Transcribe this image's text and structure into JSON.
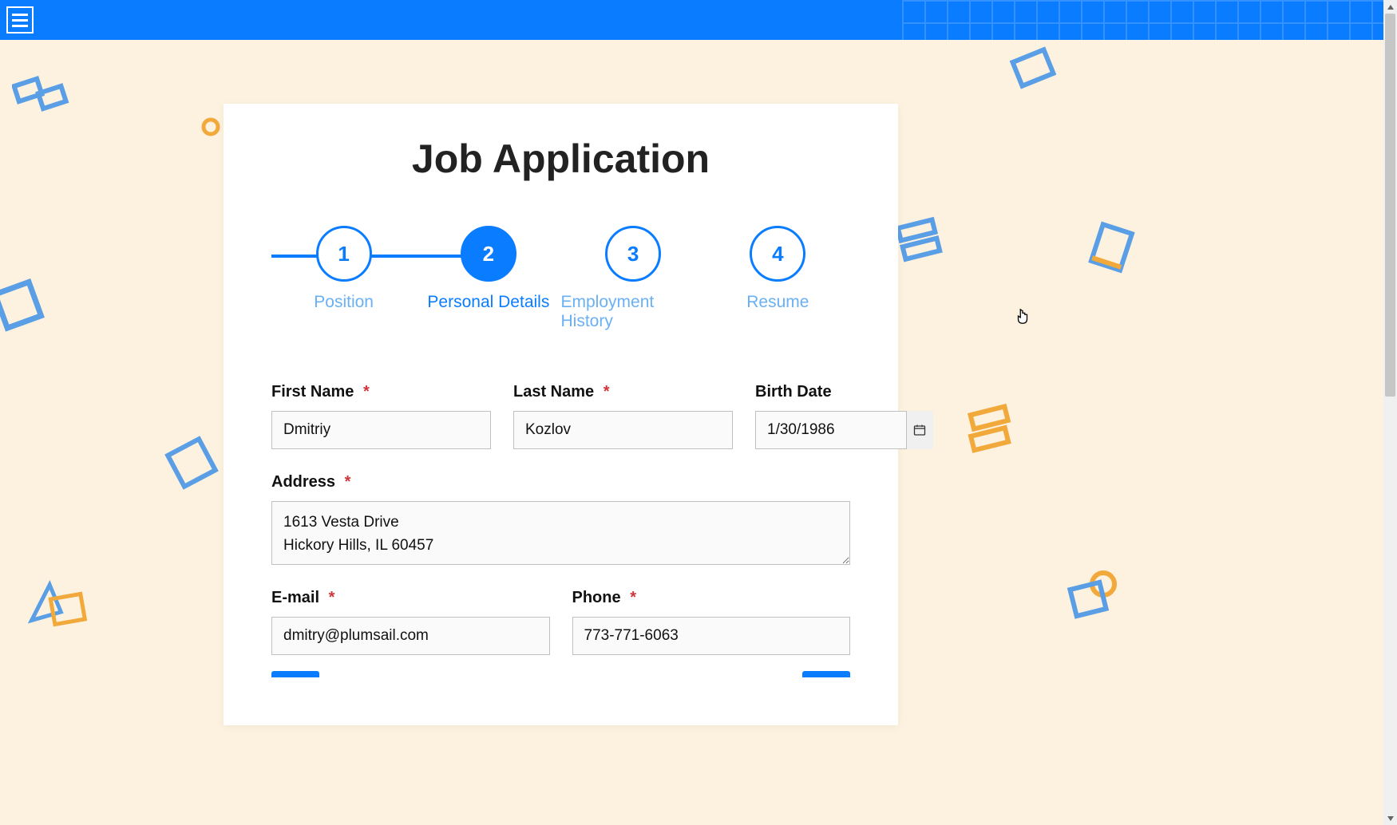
{
  "header": {
    "title": "Job Application"
  },
  "wizard": {
    "active_index": 1,
    "steps": [
      {
        "num": "1",
        "label": "Position"
      },
      {
        "num": "2",
        "label": "Personal Details"
      },
      {
        "num": "3",
        "label": "Employment History"
      },
      {
        "num": "4",
        "label": "Resume"
      }
    ]
  },
  "fields": {
    "first_name": {
      "label": "First Name",
      "required": true,
      "value": "Dmitriy"
    },
    "last_name": {
      "label": "Last Name",
      "required": true,
      "value": "Kozlov"
    },
    "birth_date": {
      "label": "Birth Date",
      "required": false,
      "value": "1/30/1986"
    },
    "address": {
      "label": "Address",
      "required": true,
      "value": "1613 Vesta Drive\nHickory Hills, IL 60457"
    },
    "email": {
      "label": "E-mail",
      "required": true,
      "value": "dmitry@plumsail.com"
    },
    "phone": {
      "label": "Phone",
      "required": true,
      "value": "773-771-6063"
    }
  },
  "required_marker": "*"
}
